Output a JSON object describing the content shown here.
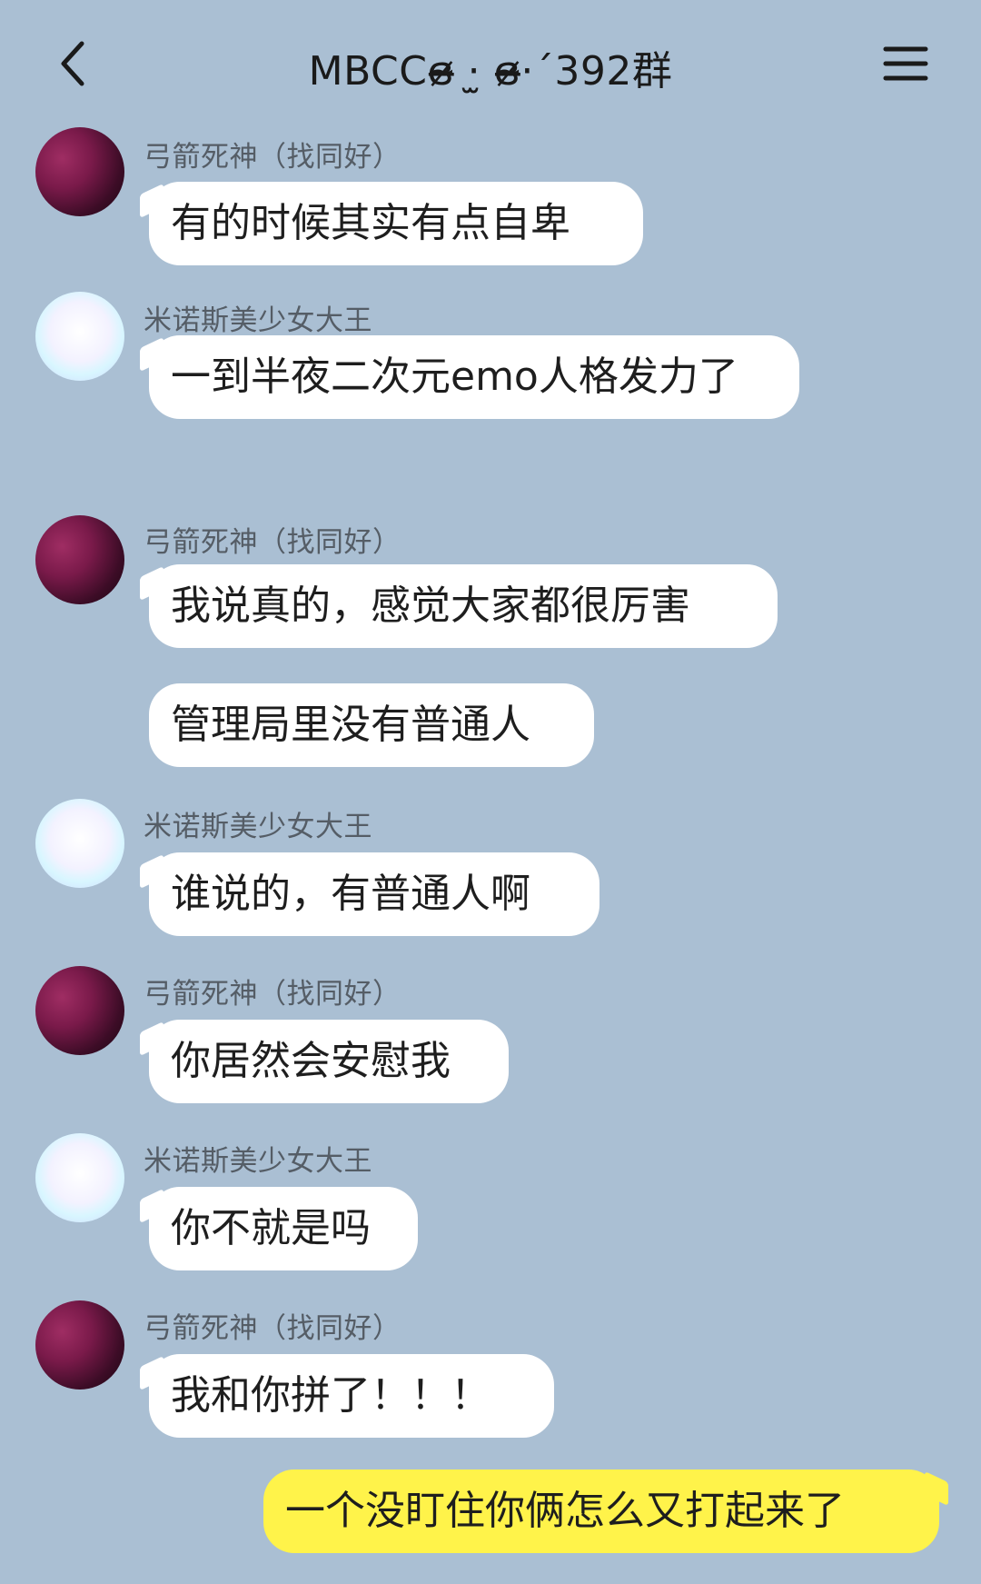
{
  "header": {
    "title": "MBCCɞ̴̶̷ ·̫ ɞ̴̶̷·´392群"
  },
  "people": {
    "a": "弓箭死神（找同好）",
    "b": "米诺斯美少女大王"
  },
  "messages": [
    {
      "sender": "弓箭死神（找同好）",
      "text": "有的时候其实有点自卑"
    },
    {
      "sender": "米诺斯美少女大王",
      "text": "一到半夜二次元emo人格发力了"
    },
    {
      "sender": "弓箭死神（找同好）",
      "text": "我说真的，感觉大家都很厉害"
    },
    {
      "sender": "",
      "text": "管理局里没有普通人"
    },
    {
      "sender": "米诺斯美少女大王",
      "text": "谁说的，有普通人啊"
    },
    {
      "sender": "弓箭死神（找同好）",
      "text": "你居然会安慰我"
    },
    {
      "sender": "米诺斯美少女大王",
      "text": "你不就是吗"
    },
    {
      "sender": "弓箭死神（找同好）",
      "text": "我和你拼了！！！"
    },
    {
      "sender": "me",
      "text": "一个没盯住你俩怎么又打起来了"
    }
  ],
  "colors": {
    "background": "#aabfd3",
    "bubble_other": "#ffffff",
    "bubble_mine": "#fff34a"
  },
  "icons": {
    "back": "chevron-left-icon",
    "menu": "hamburger-menu-icon"
  }
}
